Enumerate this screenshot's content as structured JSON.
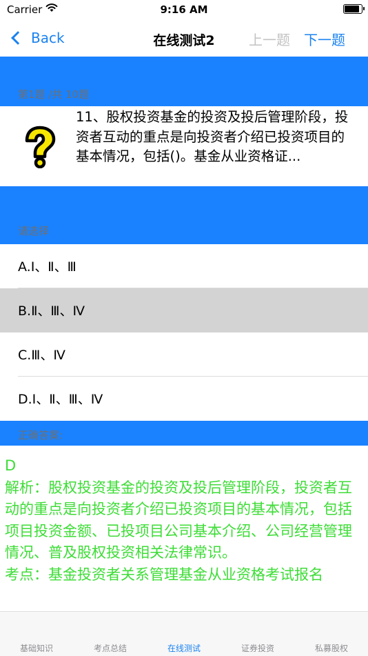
{
  "status_bar": {
    "carrier": "Carrier",
    "time": "9:16 AM"
  },
  "nav": {
    "back_label": "Back",
    "title": "在线测试2",
    "prev_label": "上一题",
    "next_label": "下一题"
  },
  "question": {
    "counter": "第1题 /共 10题",
    "text": "11、股权投资基金的投资及投后管理阶段，投资者互动的重点是向投资者介绍已投资项目的基本情况，包括()。基金从业资格证..."
  },
  "choose_prompt": "请选择",
  "options": [
    {
      "label": "A.Ⅰ、Ⅱ、Ⅲ"
    },
    {
      "label": "B.Ⅱ、Ⅲ、Ⅳ"
    },
    {
      "label": "C.Ⅲ、Ⅳ"
    },
    {
      "label": "D.Ⅰ、Ⅱ、Ⅲ、Ⅳ"
    }
  ],
  "answer_header": "正确答案:",
  "answer_text": "D\n解析：股权投资基金的投资及投后管理阶段，投资者互动的重点是向投资者介绍已投资项目的基本情况，包括项目投资金额、已投项目公司基本介绍、公司经营管理情况、普及股权投资相关法律常识。\n考点：基金投资者关系管理基金从业资格考试报名",
  "tabs": [
    {
      "label": "基础知识"
    },
    {
      "label": "考点总结"
    },
    {
      "label": "在线测试"
    },
    {
      "label": "证券投资"
    },
    {
      "label": "私募股权"
    }
  ],
  "colors": {
    "accent": "#1a82f0",
    "band": "#1a82ff",
    "answer": "#3ddc36",
    "disabled": "#c2c2c2"
  }
}
